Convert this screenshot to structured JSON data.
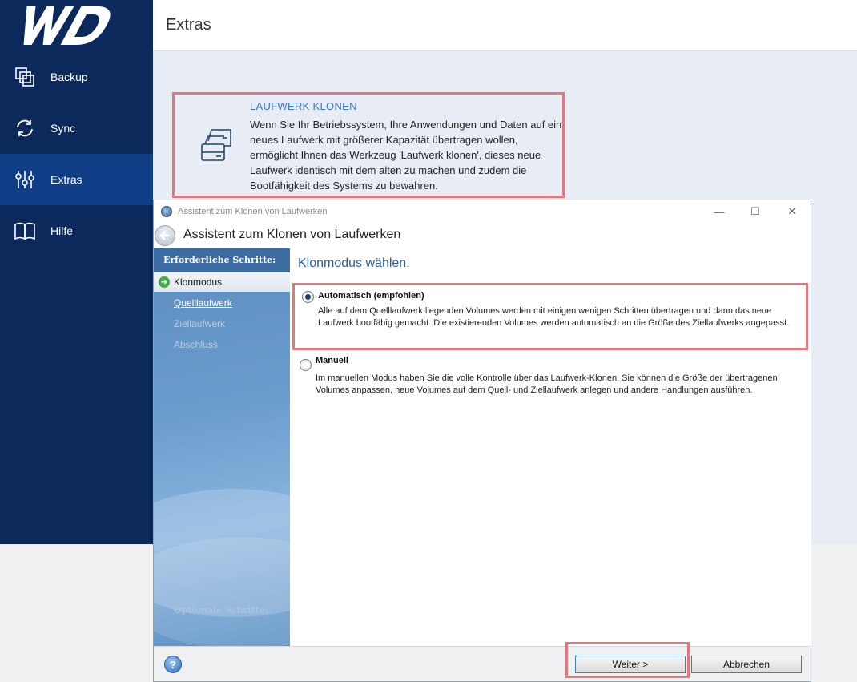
{
  "app": {
    "logo_text": "WD",
    "header_title": "Extras",
    "nav": [
      {
        "label": "Backup",
        "icon": "backup-icon"
      },
      {
        "label": "Sync",
        "icon": "sync-icon"
      },
      {
        "label": "Extras",
        "icon": "sliders-icon",
        "active": true
      },
      {
        "label": "Hilfe",
        "icon": "book-icon"
      }
    ],
    "card": {
      "title": "LAUFWERK KLONEN",
      "text": "Wenn Sie Ihr Betriebssystem, Ihre Anwendungen und Daten auf ein neues Laufwerk mit größerer Kapazität übertragen wollen, ermöglicht Ihnen das Werkzeug 'Laufwerk klonen', dieses neue Laufwerk identisch mit dem alten zu machen und zudem die Bootfähigkeit des Systems zu bewahren.",
      "icon": "drives-icon"
    }
  },
  "wizard": {
    "window_title": "Assistent zum Klonen von Laufwerken",
    "header_title": "Assistent zum Klonen von Laufwerken",
    "steps_header": "Erforderliche Schritte:",
    "steps": [
      {
        "label": "Klonmodus",
        "state": "current"
      },
      {
        "label": "Quelllaufwerk",
        "state": "link"
      },
      {
        "label": "Ziellaufwerk",
        "state": "disabled"
      },
      {
        "label": "Abschluss",
        "state": "disabled"
      }
    ],
    "optional_steps": "Optionale Schritte:",
    "main_title": "Klonmodus wählen.",
    "options": {
      "auto": {
        "label": "Automatisch (empfohlen)",
        "text": "Alle auf dem Quelllaufwerk liegenden Volumes werden mit einigen wenigen Schritten übertragen und dann das neue Laufwerk bootfähig gemacht. Die existierenden Volumes werden automatisch an die Größe des Ziellaufwerks angepasst.",
        "selected": true
      },
      "manual": {
        "label": "Manuell",
        "text": "Im manuellen Modus haben Sie die volle Kontrolle über das Laufwerk-Klonen. Sie können die Größe der übertragenen Volumes anpassen, neue Volumes auf dem Quell- und Ziellaufwerk anlegen und andere Handlungen ausführen.",
        "selected": false
      }
    },
    "buttons": {
      "next": "Weiter >",
      "cancel": "Abbrechen",
      "help": "?"
    },
    "window_controls": {
      "minimize": "—",
      "maximize": "☐",
      "close": "✕"
    }
  },
  "colors": {
    "sidebar": "#0b2a5b",
    "sidebar_active": "#103e86",
    "highlight_frame": "#e07880",
    "title_blue": "#2b5f9a"
  }
}
